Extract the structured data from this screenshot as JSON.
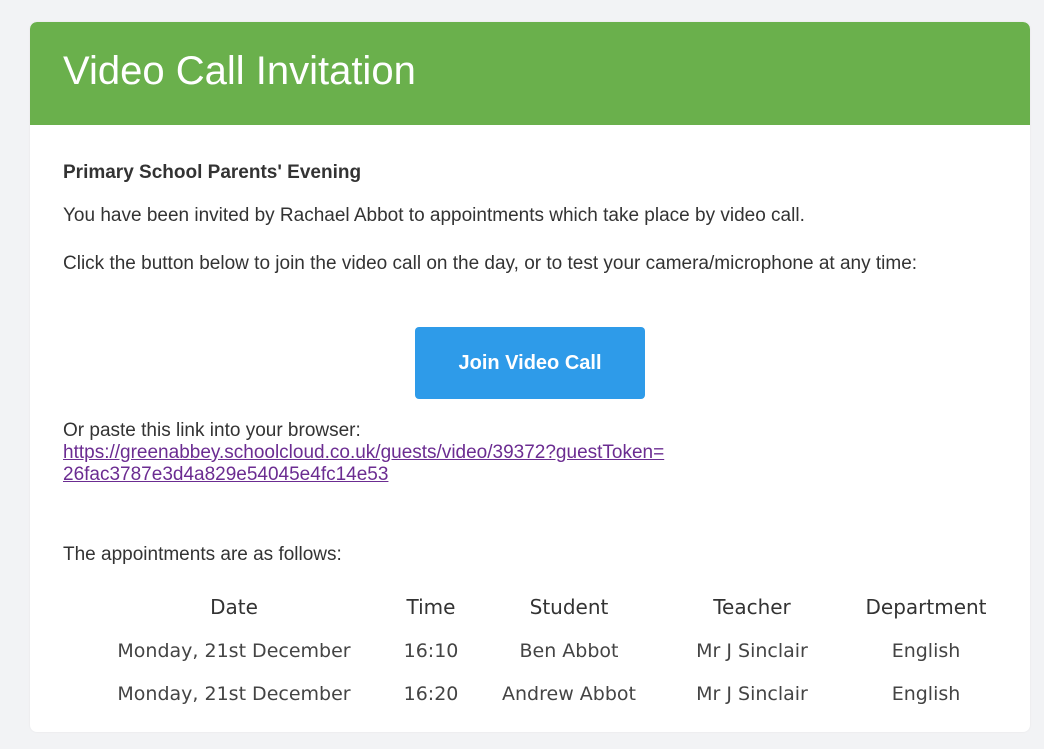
{
  "header": {
    "title": "Video Call Invitation",
    "color": "#6ab04c"
  },
  "event": {
    "name": "Primary School Parents' Evening"
  },
  "invite_text": "You have been invited by Rachael Abbot to appointments which take place by video call.",
  "instructions": "Click the button below to join the video call on the day, or to test your camera/microphone at any time:",
  "join_button": {
    "label": "Join Video Call",
    "color": "#2e9be9"
  },
  "paste": {
    "label": "Or paste this link into your browser:",
    "url": "https://greenabbey.schoolcloud.co.uk/guests/video/39372?guestToken=26fac3787e3d4a829e54045e4fc14e53"
  },
  "appointments": {
    "intro": "The appointments are as follows:",
    "columns": [
      "Date",
      "Time",
      "Student",
      "Teacher",
      "Department"
    ],
    "rows": [
      [
        "Monday, 21st December",
        "16:10",
        "Ben Abbot",
        "Mr J Sinclair",
        "English"
      ],
      [
        "Monday, 21st December",
        "16:20",
        "Andrew Abbot",
        "Mr J Sinclair",
        "English"
      ]
    ]
  }
}
